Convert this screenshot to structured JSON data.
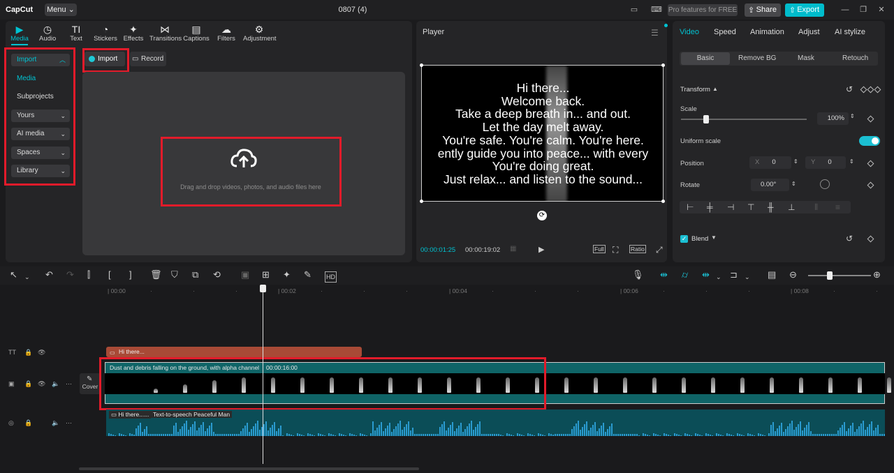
{
  "app": {
    "logo": "CapCut",
    "menu": "Menu",
    "project_title": "0807 (4)"
  },
  "header": {
    "pro_label": "Pro features for FREE",
    "share": "Share",
    "export": "Export"
  },
  "toolbar": [
    {
      "label": "Media",
      "icon": "media-icon",
      "active": true
    },
    {
      "label": "Audio",
      "icon": "audio-icon"
    },
    {
      "label": "Text",
      "icon": "text-icon"
    },
    {
      "label": "Stickers",
      "icon": "stickers-icon"
    },
    {
      "label": "Effects",
      "icon": "effects-icon"
    },
    {
      "label": "Transitions",
      "icon": "transitions-icon"
    },
    {
      "label": "Captions",
      "icon": "captions-icon"
    },
    {
      "label": "Filters",
      "icon": "filters-icon"
    },
    {
      "label": "Adjustment",
      "icon": "adjustment-icon"
    }
  ],
  "sidebar": {
    "items": [
      {
        "label": "Import",
        "expandable": true,
        "expanded": true
      },
      {
        "label": "Media",
        "active": true
      },
      {
        "label": "Subprojects"
      },
      {
        "label": "Yours",
        "expandable": true
      },
      {
        "label": "AI media",
        "expandable": true
      },
      {
        "label": "Spaces",
        "expandable": true
      },
      {
        "label": "Library",
        "expandable": true
      }
    ]
  },
  "media": {
    "import_label": "Import",
    "record_label": "Record",
    "drop_text": "Drag and drop videos, photos, and audio files here"
  },
  "player": {
    "title": "Player",
    "caption_lines": [
      "Hi there...",
      "Welcome back.",
      "Take a deep breath in... and out.",
      "Let the day melt away.",
      "You're safe. You're calm. You're here.",
      "ently guide you into peace... with every",
      "You're doing great.",
      "Just relax... and listen to the sound..."
    ],
    "current_time": "00:00:01:25",
    "total_time": "00:00:19:02",
    "full_label": "Full",
    "ratio_label": "Ratio"
  },
  "inspector": {
    "tabs": [
      "Video",
      "Speed",
      "Animation",
      "Adjust",
      "AI stylize"
    ],
    "subtabs": [
      "Basic",
      "Remove BG",
      "Mask",
      "Retouch"
    ],
    "transform_label": "Transform",
    "scale_label": "Scale",
    "scale_value": "100%",
    "uniform_scale_label": "Uniform scale",
    "position_label": "Position",
    "pos_x_label": "X",
    "pos_x": "0",
    "pos_y_label": "Y",
    "pos_y": "0",
    "rotate_label": "Rotate",
    "rotate_value": "0.00°",
    "blend_label": "Blend"
  },
  "timeline": {
    "ticks": [
      "00:00",
      "00:02",
      "00:04",
      "00:06",
      "00:08"
    ],
    "text_clip": "Hi there...",
    "video_clip_name": "Dust and debris falling on the ground, with alpha channel",
    "video_clip_duration": "00:00:16:00",
    "cover_label": "Cover",
    "audio_clip_text": "Hi there......",
    "audio_clip_name": "Text-to-speech Peaceful Man"
  },
  "colors": {
    "accent": "#00c2d1",
    "highlight": "#e21b2a",
    "text_clip": "#a84a36",
    "video_clip": "#0f6467"
  }
}
